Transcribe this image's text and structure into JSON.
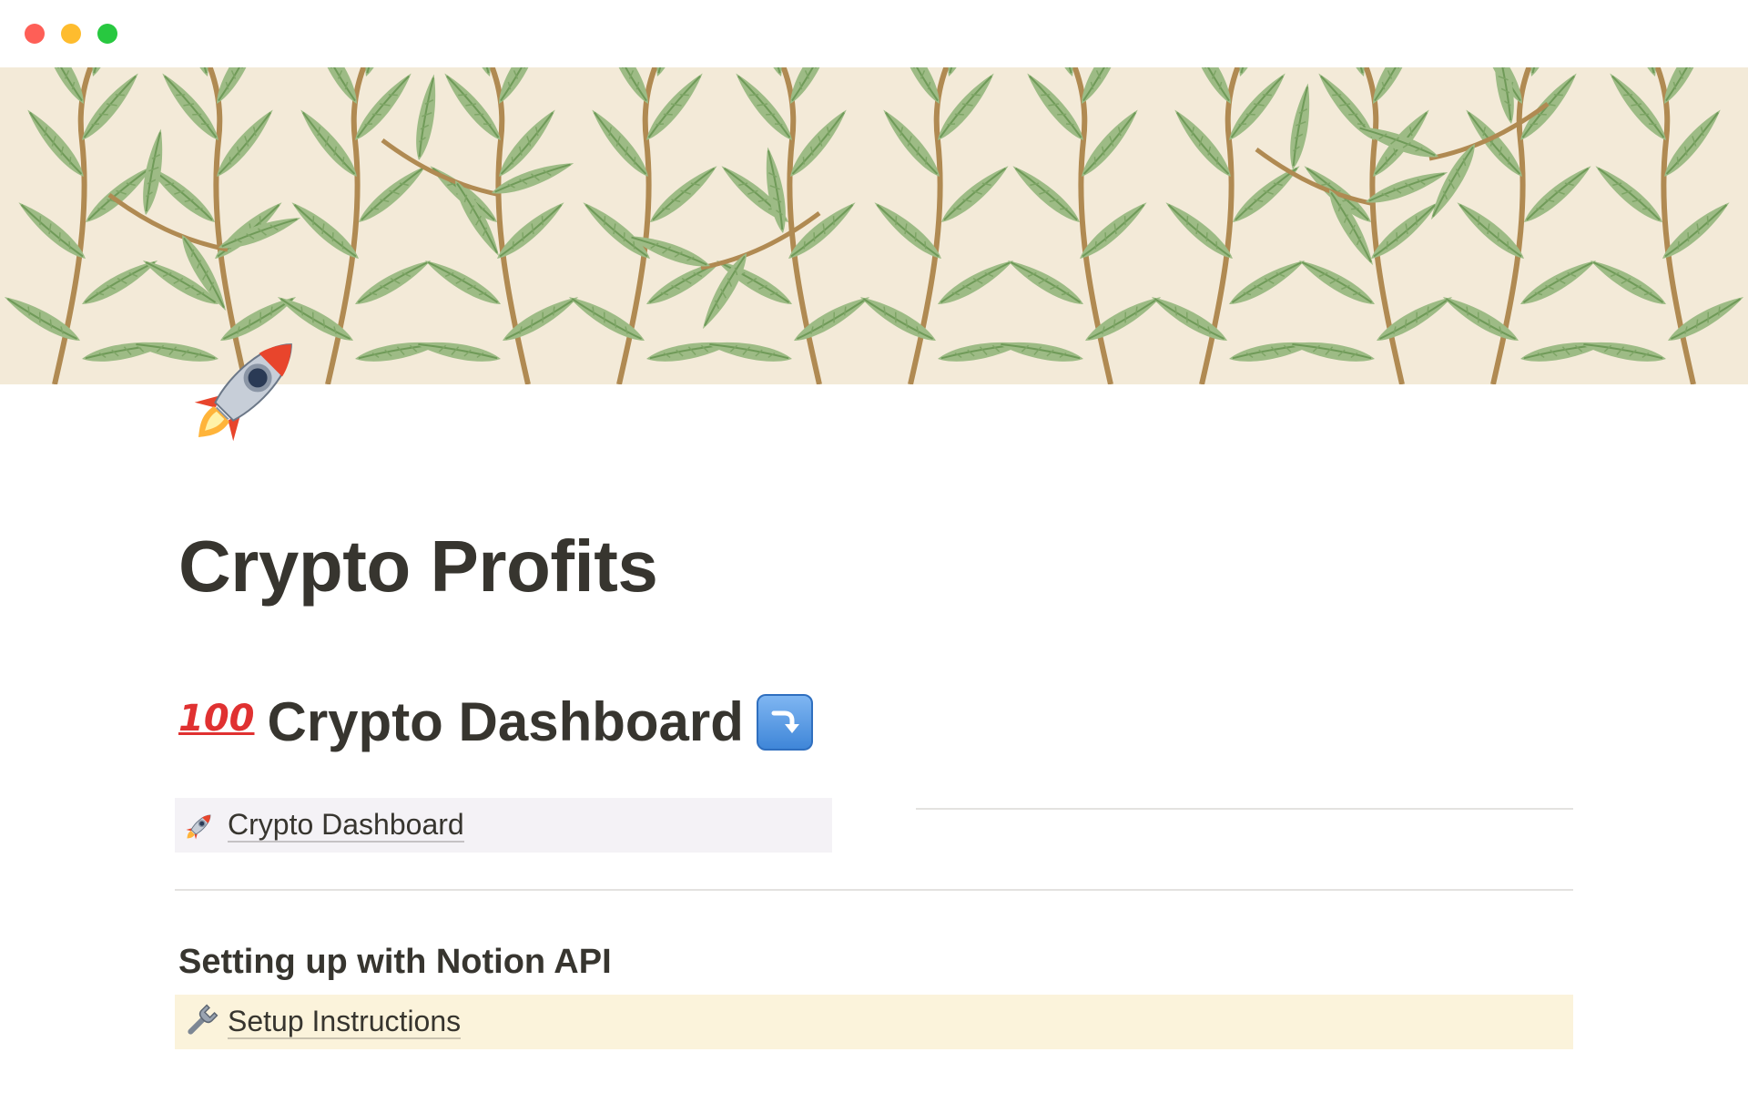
{
  "window": {
    "controls": [
      "close",
      "minimize",
      "maximize"
    ]
  },
  "cover": {
    "icon": "willow-leaf-pattern-cover"
  },
  "page": {
    "icon": "rocket-icon",
    "title": "Crypto Profits"
  },
  "dashboard_section": {
    "prefix_icon": "hundred-points-icon",
    "prefix_text": "100",
    "heading": "Crypto Dashboard",
    "suffix_icon": "arrow-curving-down-icon"
  },
  "dashboard_link": {
    "icon": "rocket-icon",
    "label": "Crypto Dashboard"
  },
  "setup_section": {
    "heading": "Setting up with Notion API"
  },
  "setup_link": {
    "icon": "wrench-icon",
    "label": "Setup Instructions"
  },
  "colors": {
    "text": "#37352f",
    "dashboard_link_bg": "#f4f2f6",
    "setup_link_bg": "#fbf3db",
    "cover_bg": "#f3ead8",
    "leaf_green": "#9dbb85",
    "stem_brown": "#b08a52"
  }
}
